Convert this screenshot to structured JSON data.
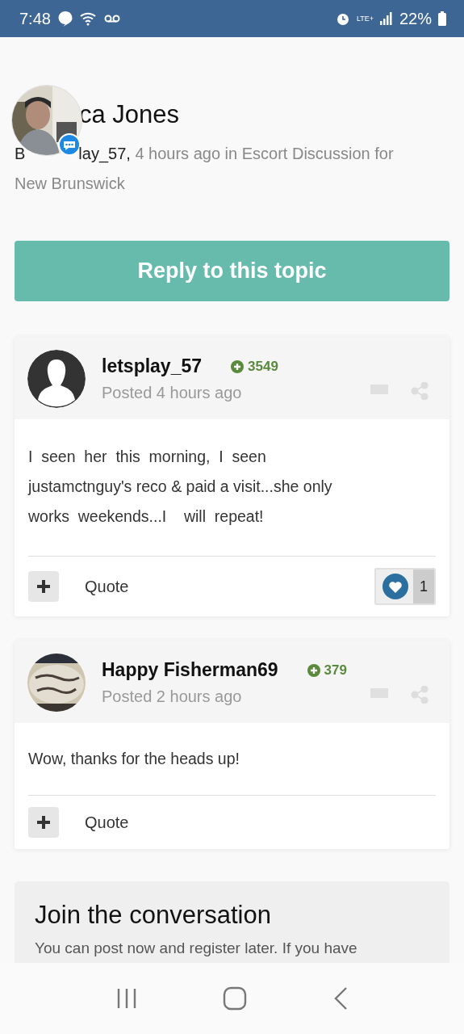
{
  "status_bar": {
    "time": "7:48",
    "network": "LTE+",
    "battery": "22%"
  },
  "topic": {
    "title": "ca Jones",
    "byline_start": "B",
    "author": "lay_57,",
    "meta": "4 hours ago in Escort Discussion for",
    "meta_continued": "New Brunswick"
  },
  "reply_button": "Reply to this topic",
  "posts": [
    {
      "author": "letsplay_57",
      "reputation": "3549",
      "posted": "Posted 4 hours ago",
      "avatar": {
        "kind": "silhouette"
      },
      "body": "I  seen  her  this  morning,  I  seen\njustamctnguy's reco & paid a visit...she only\nworks  weekends...I    will  repeat!",
      "quote": "Quote",
      "likes": "1"
    },
    {
      "author": "Happy Fisherman69",
      "reputation": "379",
      "posted": "Posted 2 hours ago",
      "body": "Wow, thanks for the heads up!",
      "quote": "Quote"
    }
  ],
  "join": {
    "title": "Join the conversation",
    "text": "You can post now and register later. If you have"
  }
}
